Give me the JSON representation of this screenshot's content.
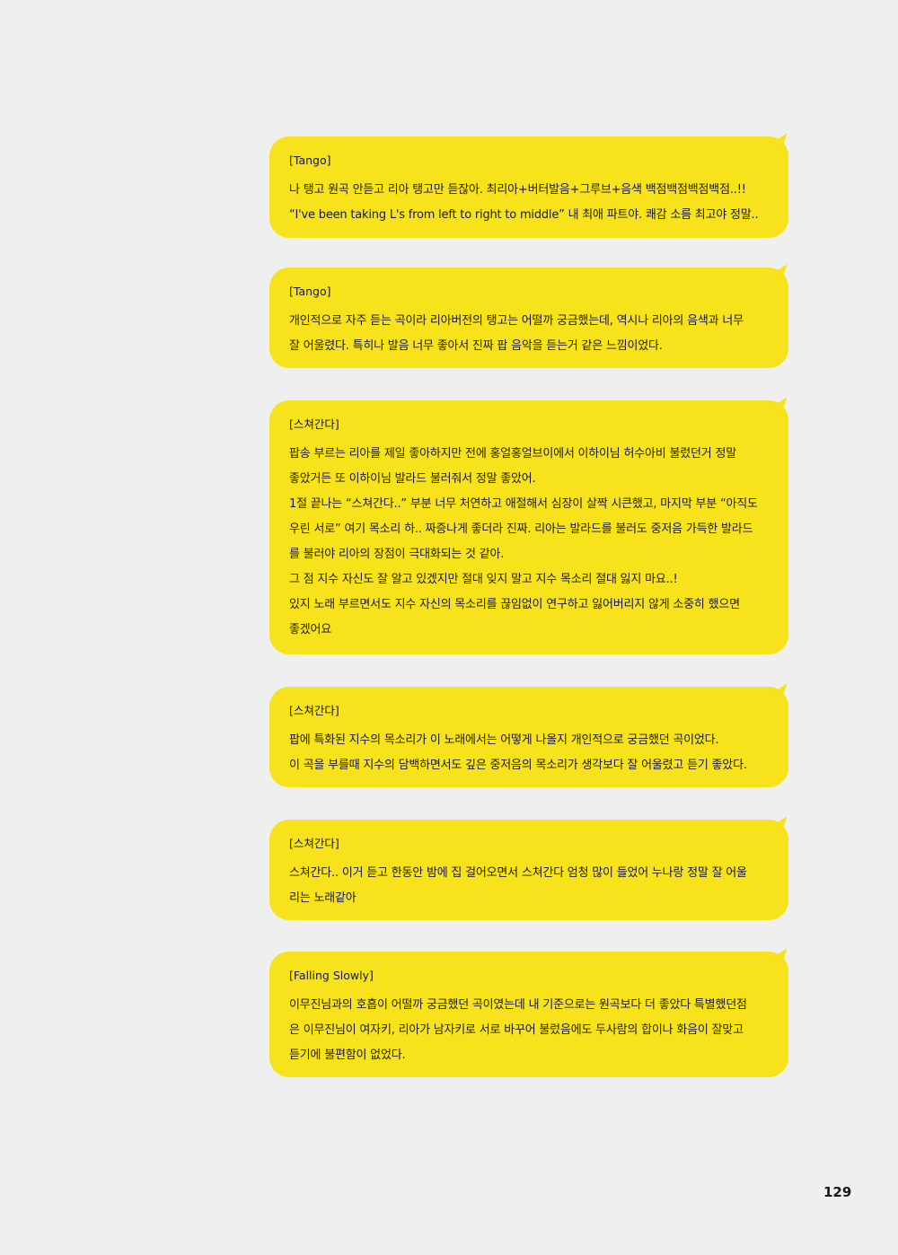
{
  "bubbles": [
    {
      "title": "[Tango]",
      "lines": [
        "나 탱고 원곡 안듣고 리아 탱고만 듣잖아. 최리아+버터발음+그루브+음색 백점백점백점백점..!!",
        "“I've been taking L's from left to right to middle” 내 최애 파트야. 쾌감 소름 최고야 정말.."
      ]
    },
    {
      "title": "[Tango]",
      "lines": [
        "개인적으로 자주 듣는 곡이라 리아버전의 탱고는 어떨까 궁금했는데, 역시나 리아의 음색과 너무",
        "잘 어울렸다. 특히나 발음 너무 좋아서 진짜 팝 음악을 듣는거 같은 느낌이었다."
      ]
    },
    {
      "title": "[스쳐간다]",
      "lines": [
        "팝송 부르는 리아를 제일 좋아하지만 전에 홍얼홍얼브이에서 이하이님 허수아비 불렀던거 정말",
        "좋았거든 또 이하이님 발라드 불러줘서 정말 좋았어.",
        "1절 끝나는 “스쳐간다..” 부분 너무 처연하고 애절해서 심장이 살짝 시큰했고, 마지막 부분 “아직도",
        "우린 서로” 여기 목소리 하.. 짜증나게 좋더라 진짜. 리아는 발라드를 불러도 중저음 가득한 발라드",
        "를 불러야 리아의 장점이 극대화되는 것 같아.",
        "그 점 지수 자신도 잘 알고 있겠지만 절대 잊지 말고 지수 목소리 절대 잃지 마요..!",
        "있지 노래 부르면서도 지수 자신의 목소리를 끊임없이 연구하고 잃어버리지 않게 소중히 했으면",
        "좋겠어요"
      ]
    },
    {
      "title": "[스쳐간다]",
      "lines": [
        "팝에 특화된 지수의 목소리가 이 노래에서는 어떻게 나올지 개인적으로 궁금했던 곡이었다.",
        "이 곡을 부를때 지수의 담백하면서도 깊은 중저음의 목소리가 생각보다 잘 어울렸고 듣기 좋았다."
      ]
    },
    {
      "title": "[스쳐간다]",
      "lines": [
        "스쳐간다.. 이거 듣고 한동안 밤에 집 걸어오면서 스쳐간다 엄청 많이 들었어 누나랑 정말 잘 어울",
        "리는 노래같아"
      ]
    },
    {
      "title": "[Falling Slowly]",
      "lines": [
        "이무진님과의 호흡이 어떨까 궁금했던 곡이였는데 내 기준으로는 원곡보다 더 좋았다 특별했던점",
        "은 이무진님이 여자키, 리아가 남자키로 서로 바꾸어 불렀음에도 두사람의 합이나 화음이 잘맞고",
        "듣기에 불편함이 없었다."
      ]
    }
  ],
  "page_number": "129",
  "colors": {
    "bubble": "#f7e21b",
    "background": "#efefef"
  }
}
